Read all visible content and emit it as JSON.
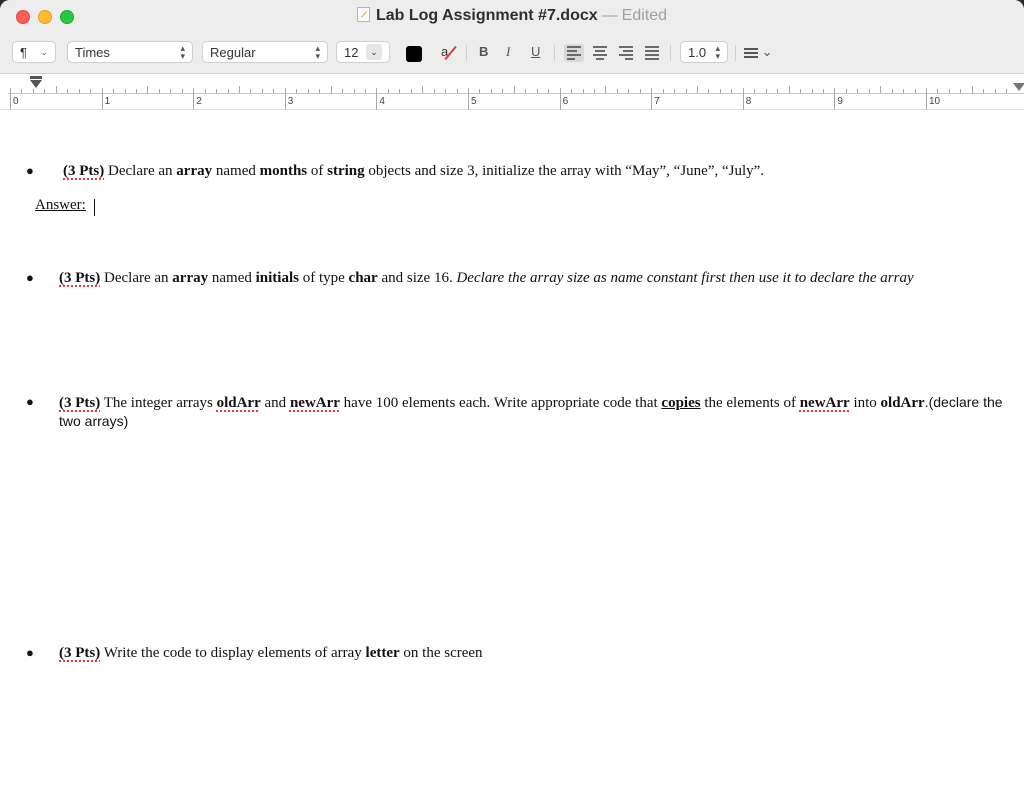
{
  "window": {
    "filename": "Lab Log Assignment #7.docx",
    "separator": "—",
    "status": "Edited"
  },
  "toolbar": {
    "paragraph_symbol": "¶",
    "font_family": "Times",
    "font_style": "Regular",
    "font_size": "12",
    "text_color": "#000000",
    "highlight_glyph": "a",
    "bold_label": "B",
    "italic_label": "I",
    "underline_label": "U",
    "line_spacing": "1.0",
    "active_alignment": "left"
  },
  "ruler": {
    "numbers": [
      "0",
      "1",
      "2",
      "3",
      "4",
      "5",
      "6",
      "7",
      "8",
      "9",
      "10"
    ]
  },
  "document": {
    "q1": {
      "pts": "(3 Pts)",
      "t1": " Declare an ",
      "b1": "array",
      "t2": " named ",
      "b2": "months",
      "t3": " of ",
      "b3": "string",
      "t4": " objects and size 3, initialize the array with “May”, “June”, “July”."
    },
    "answer_label": "Answer:",
    "q2": {
      "pts": "(3 Pts)",
      "t1": " Declare an ",
      "b1": "array",
      "t2": " named ",
      "b2": "initials",
      "t3": " of type ",
      "b3": "char",
      "t4": " and size 16. ",
      "i1": "Declare the array size as name constant first then use it to declare the array"
    },
    "q3": {
      "pts": "(3 Pts)",
      "t1": " The integer arrays ",
      "b1": "oldArr",
      "t2": " and ",
      "b2": "newArr",
      "t3": " have 100 elements each. Write appropriate code that ",
      "b3": "copies",
      "t4": " the elements of ",
      "b4": "newArr",
      "t5": " into ",
      "b5": "oldArr",
      "t6": ".(declare the",
      "line2": "two arrays)"
    },
    "q4": {
      "pts": "(3 Pts)",
      "t1": " Write the code to display elements of array ",
      "b1": "letter",
      "t2": " on the screen"
    }
  }
}
